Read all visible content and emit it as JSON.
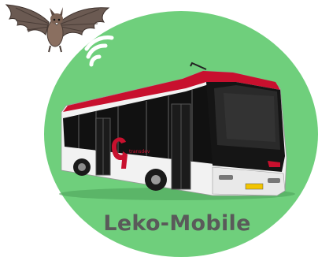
{
  "brand": {
    "name": "Leko-Mobile",
    "circle_color": "#6fcf7c",
    "text_color": "#5a5a5a"
  },
  "bus": {
    "livery_colors": [
      "#c8102e",
      "#111111",
      "#f2f2f2"
    ],
    "side_logo_text": "transdev",
    "plate_text": "BX-RX-30"
  },
  "icons": [
    "bat-icon",
    "wifi-signal-icon",
    "bus-illustration"
  ]
}
